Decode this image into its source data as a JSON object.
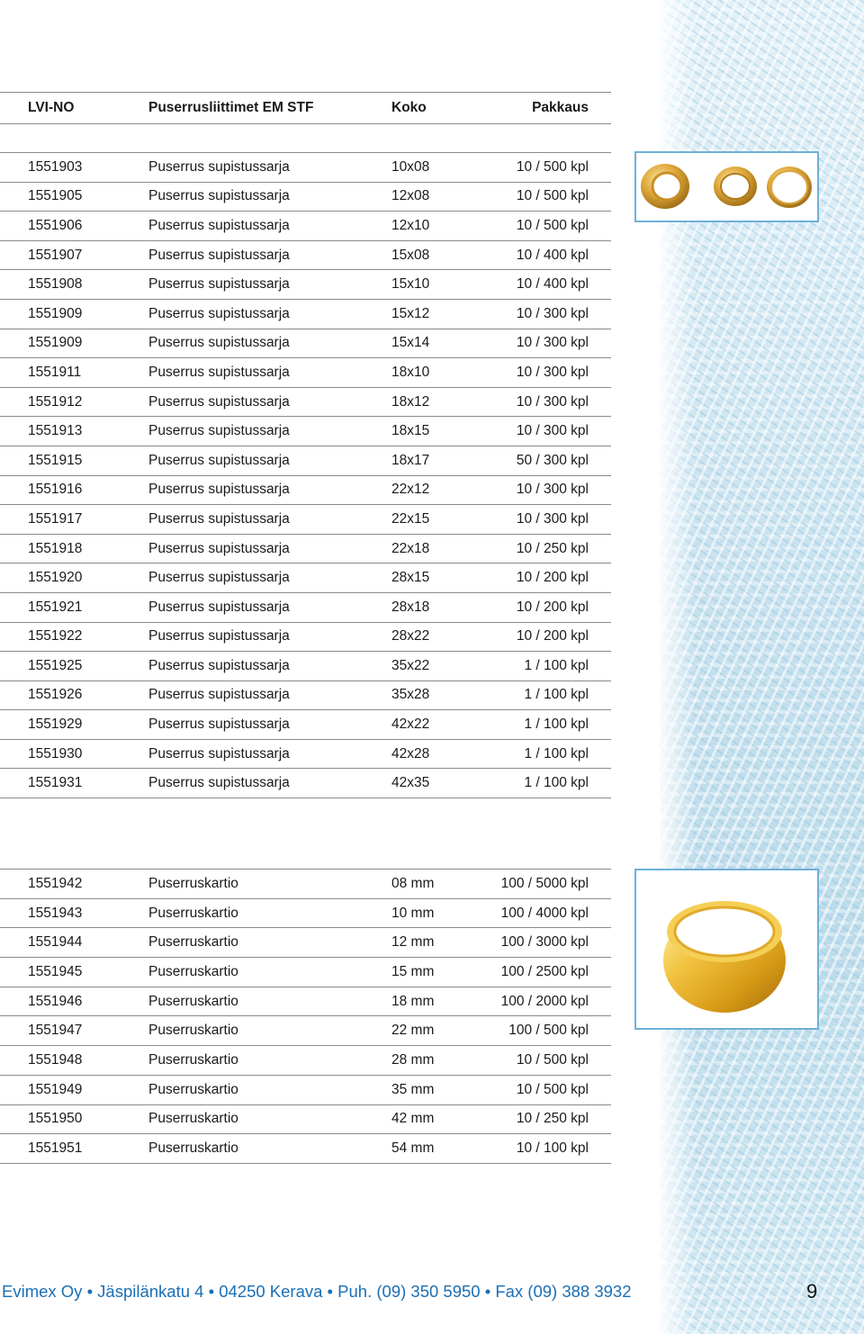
{
  "header": {
    "code": "LVI-NO",
    "name": "Puserrusliittimet EM STF",
    "size": "Koko",
    "pack": "Pakkaus"
  },
  "table1": [
    [
      "1551903",
      "Puserrus supistussarja",
      "10x08",
      "10 / 500 kpl"
    ],
    [
      "1551905",
      "Puserrus supistussarja",
      "12x08",
      "10 / 500 kpl"
    ],
    [
      "1551906",
      "Puserrus supistussarja",
      "12x10",
      "10 / 500 kpl"
    ],
    [
      "1551907",
      "Puserrus supistussarja",
      "15x08",
      "10 / 400 kpl"
    ],
    [
      "1551908",
      "Puserrus supistussarja",
      "15x10",
      "10 / 400 kpl"
    ],
    [
      "1551909",
      "Puserrus supistussarja",
      "15x12",
      "10 / 300 kpl"
    ],
    [
      "1551909",
      "Puserrus supistussarja",
      "15x14",
      "10 / 300 kpl"
    ],
    [
      "1551911",
      "Puserrus supistussarja",
      "18x10",
      "10 / 300 kpl"
    ],
    [
      "1551912",
      "Puserrus supistussarja",
      "18x12",
      "10 / 300 kpl"
    ],
    [
      "1551913",
      "Puserrus supistussarja",
      "18x15",
      "10 / 300 kpl"
    ],
    [
      "1551915",
      "Puserrus supistussarja",
      "18x17",
      "50 / 300 kpl"
    ],
    [
      "1551916",
      "Puserrus supistussarja",
      "22x12",
      "10 / 300 kpl"
    ],
    [
      "1551917",
      "Puserrus supistussarja",
      "22x15",
      "10 / 300 kpl"
    ],
    [
      "1551918",
      "Puserrus supistussarja",
      "22x18",
      "10 / 250 kpl"
    ],
    [
      "1551920",
      "Puserrus supistussarja",
      "28x15",
      "10 / 200 kpl"
    ],
    [
      "1551921",
      "Puserrus supistussarja",
      "28x18",
      "10 / 200 kpl"
    ],
    [
      "1551922",
      "Puserrus supistussarja",
      "28x22",
      "10 / 200 kpl"
    ],
    [
      "1551925",
      "Puserrus supistussarja",
      "35x22",
      "1 / 100 kpl"
    ],
    [
      "1551926",
      "Puserrus supistussarja",
      "35x28",
      "1 / 100 kpl"
    ],
    [
      "1551929",
      "Puserrus supistussarja",
      "42x22",
      "1 / 100 kpl"
    ],
    [
      "1551930",
      "Puserrus supistussarja",
      "42x28",
      "1 / 100 kpl"
    ],
    [
      "1551931",
      "Puserrus supistussarja",
      "42x35",
      "1 / 100 kpl"
    ]
  ],
  "table2": [
    [
      "1551942",
      "Puserruskartio",
      "08 mm",
      "100 / 5000 kpl"
    ],
    [
      "1551943",
      "Puserruskartio",
      "10 mm",
      "100 / 4000 kpl"
    ],
    [
      "1551944",
      "Puserruskartio",
      "12 mm",
      "100 / 3000 kpl"
    ],
    [
      "1551945",
      "Puserruskartio",
      "15 mm",
      "100 / 2500 kpl"
    ],
    [
      "1551946",
      "Puserruskartio",
      "18 mm",
      "100 / 2000 kpl"
    ],
    [
      "1551947",
      "Puserruskartio",
      "22 mm",
      "100 / 500 kpl"
    ],
    [
      "1551948",
      "Puserruskartio",
      "28 mm",
      "10 / 500 kpl"
    ],
    [
      "1551949",
      "Puserruskartio",
      "35 mm",
      "10 / 500 kpl"
    ],
    [
      "1551950",
      "Puserruskartio",
      "42 mm",
      "10 / 250 kpl"
    ],
    [
      "1551951",
      "Puserruskartio",
      "54 mm",
      "10 / 100 kpl"
    ]
  ],
  "footer": {
    "text": "Evimex Oy • Jäspilänkatu 4 • 04250 Kerava • Puh. (09) 350 5950 • Fax (09) 388 3932",
    "page_number": "9"
  },
  "colors": {
    "footer_blue": "#1a6fb5",
    "photo_border": "#6fb0d8",
    "brass": "#e8b84a"
  }
}
